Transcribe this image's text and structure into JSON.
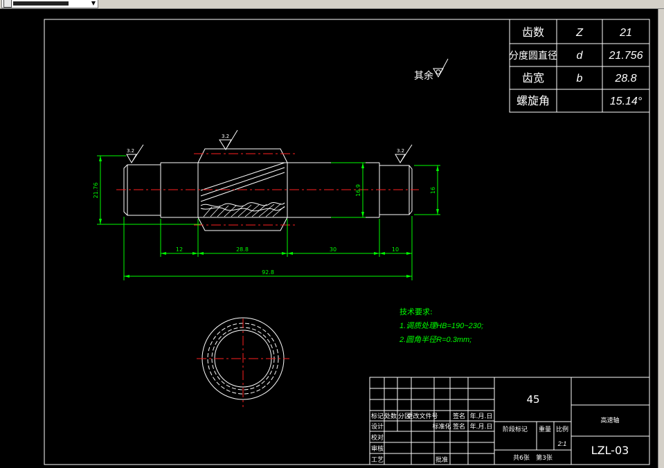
{
  "gear_table": {
    "rows": [
      {
        "name": "齿数",
        "symbol": "Z",
        "value": "21"
      },
      {
        "name": "分度圆直径",
        "symbol": "d",
        "value": "21.756"
      },
      {
        "name": "齿宽",
        "symbol": "b",
        "value": "28.8"
      },
      {
        "name": "螺旋角",
        "symbol": "",
        "value": "15.14°"
      }
    ]
  },
  "roughness": {
    "other": "其余",
    "left": "3.2",
    "mid": "3.2",
    "right": "3.2"
  },
  "dimensions": {
    "dia_left": "21.76",
    "dia_mid": "16.9",
    "dia_right": "16",
    "len_12": "12",
    "len_288": "28.8",
    "len_30": "30",
    "len_10": "10",
    "total": "92.8"
  },
  "tech": {
    "title": "技术要求:",
    "line1": "1.调质处理HB=190~230;",
    "line2": "2.圆角半径R=0.3mm;"
  },
  "title_block": {
    "material": "45",
    "part_name": "高速轴",
    "drawing_no": "LZL-03",
    "scale": "2:1",
    "h_mark": "标记",
    "h_count": "处数",
    "h_zone": "分区",
    "h_doc": "更改文件号",
    "h_sign": "签名",
    "h_date": "年.月.日",
    "design": "设计",
    "standard": "标准化",
    "check": "校对",
    "review": "审核",
    "craft": "工艺",
    "approve": "批准",
    "stage": "阶段标记",
    "weight": "重量",
    "ratio": "比例",
    "sheets": "共6张",
    "sheet": "第3张"
  },
  "colors": {
    "bg": "#000000",
    "outline": "#ffffff",
    "center": "#ff2020",
    "dim": "#00ff00",
    "text": "#ffffff"
  }
}
